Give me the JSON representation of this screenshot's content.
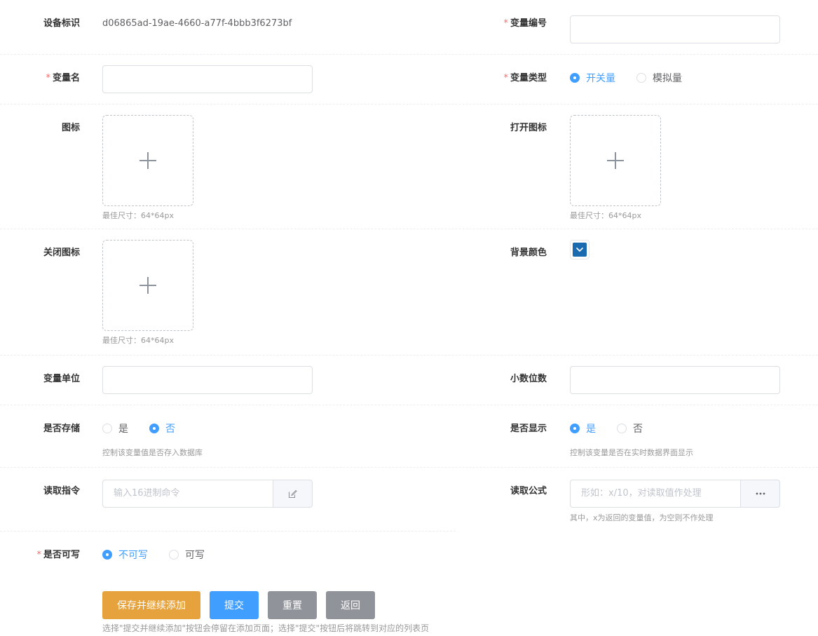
{
  "device_id": {
    "label": "设备标识",
    "value": "d06865ad-19ae-4660-a77f-4bbb3f6273bf"
  },
  "variable_code": {
    "label": "变量编号",
    "required": "*",
    "value": ""
  },
  "variable_name": {
    "label": "变量名",
    "required": "*",
    "value": ""
  },
  "variable_type": {
    "label": "变量类型",
    "required": "*",
    "options": [
      "开关量",
      "模拟量"
    ],
    "selected": "开关量"
  },
  "icon": {
    "label": "图标",
    "hint": "最佳尺寸：64*64px"
  },
  "open_icon": {
    "label": "打开图标",
    "hint": "最佳尺寸：64*64px"
  },
  "close_icon": {
    "label": "关闭图标",
    "hint": "最佳尺寸：64*64px"
  },
  "bg_color": {
    "label": "背景颜色",
    "value": "#1a6aaf"
  },
  "variable_unit": {
    "label": "变量单位",
    "value": ""
  },
  "decimal_places": {
    "label": "小数位数",
    "value": ""
  },
  "is_stored": {
    "label": "是否存储",
    "options": [
      "是",
      "否"
    ],
    "selected": "否",
    "hint": "控制该变量值是否存入数据库"
  },
  "is_displayed": {
    "label": "是否显示",
    "options": [
      "是",
      "否"
    ],
    "selected": "是",
    "hint": "控制该变量是否在实时数据界面显示"
  },
  "read_command": {
    "label": "读取指令",
    "placeholder": "输入16进制命令",
    "append_icon": "edit-icon"
  },
  "read_formula": {
    "label": "读取公式",
    "placeholder": "形如：x/10，对读取值作处理",
    "append_icon": "more-icon",
    "hint": "其中，x为返回的变量值，为空则不作处理"
  },
  "is_writable": {
    "label": "是否可写",
    "required": "*",
    "options": [
      "不可写",
      "可写"
    ],
    "selected": "不可写"
  },
  "buttons": {
    "save_continue": "保存并继续添加",
    "submit": "提交",
    "reset": "重置",
    "back": "返回"
  },
  "footer_hint": "选择\"提交并继续添加\"按钮会停留在添加页面；选择\"提交\"按钮后将跳转到对应的列表页",
  "colors": {
    "primary": "#409eff",
    "warning": "#e6a23c",
    "info": "#909399",
    "danger": "#f56c6c"
  }
}
